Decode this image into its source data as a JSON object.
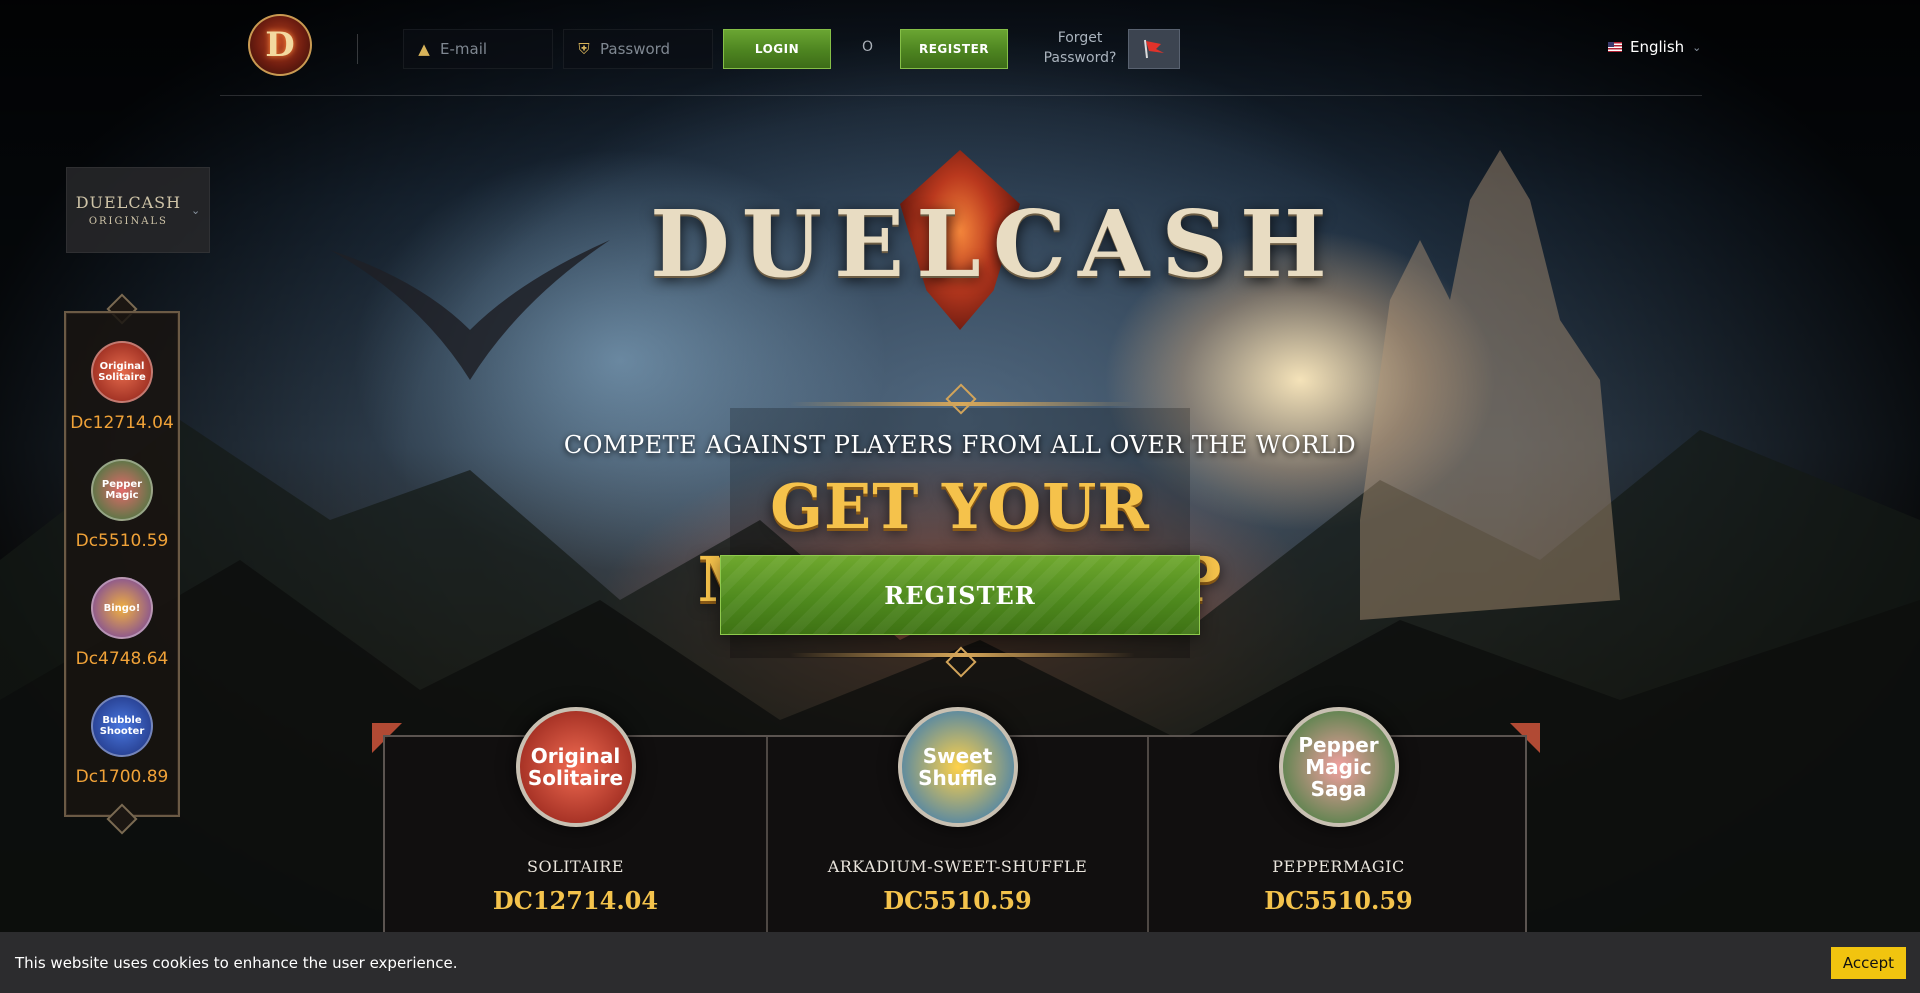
{
  "header": {
    "logo_letter": "D",
    "email_placeholder": "E-mail",
    "password_placeholder": "Password",
    "login_label": "LOGIN",
    "or_label": "O",
    "register_label": "REGISTER",
    "forget_line1": "Forget",
    "forget_line2": "Password?",
    "language": "English"
  },
  "originals": {
    "line1": "DUELCASH",
    "line2": "ORIGINALS"
  },
  "side_list": [
    {
      "icon_text": "Original Solitaire",
      "value": "Dc12714.04",
      "color": "#b8312a"
    },
    {
      "icon_text": "Pepper Magic",
      "value": "Dc5510.59",
      "color": "#2f7a3a"
    },
    {
      "icon_text": "Bingo!",
      "value": "Dc4748.64",
      "color": "#6b3aa8"
    },
    {
      "icon_text": "Bubble Shooter",
      "value": "Dc1700.89",
      "color": "#1d3f9a"
    }
  ],
  "hero": {
    "brand": "DUELCASH",
    "tagline": "COMPETE AGAINST PLAYERS FROM ALL OVER THE WORLD",
    "headline": "GET YOUR MEMBERSHIP",
    "register_label": "REGISTER"
  },
  "games": [
    {
      "icon_text": "Original Solitaire",
      "name": "SOLITAIRE",
      "value": "DC12714.04",
      "color": "#b52a22"
    },
    {
      "icon_text": "Sweet Shuffle",
      "name": "ARKADIUM-SWEET-SHUFFLE",
      "value": "DC5510.59",
      "color": "#1f78c4"
    },
    {
      "icon_text": "Pepper Magic Saga",
      "name": "PEPPERMAGIC",
      "value": "DC5510.59",
      "color": "#2c7a34"
    }
  ],
  "cookie": {
    "text": "This website uses cookies to enhance the user experience.",
    "accept_label": "Accept"
  }
}
